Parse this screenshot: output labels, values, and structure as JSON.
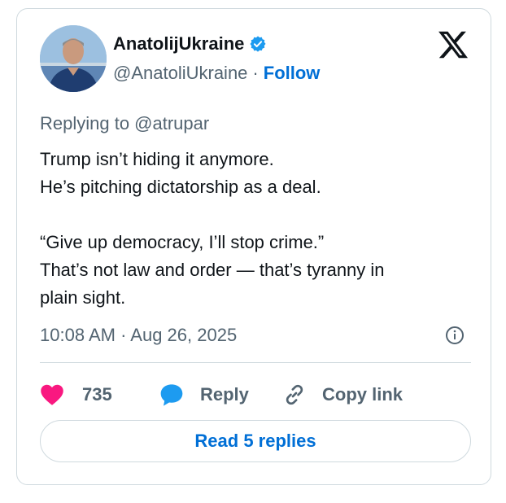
{
  "author": {
    "display_name": "AnatolijUkraine",
    "handle": "@AnatoliUkraine",
    "separator": "·",
    "follow_label": "Follow",
    "verified": true
  },
  "tweet": {
    "replying_to": "Replying to @atrupar",
    "lines": [
      "Trump isn’t hiding it anymore.",
      "He’s pitching dictatorship as a deal.",
      "",
      "“Give up democracy, I’ll stop crime.”",
      "That’s not law and order — that’s tyranny in",
      "plain sight."
    ],
    "timestamp": "10:08 AM · Aug 26, 2025"
  },
  "actions": {
    "like_count": "735",
    "reply_label": "Reply",
    "copy_link_label": "Copy link"
  },
  "read_replies_label": "Read 5 replies",
  "colors": {
    "accent": "#006fd6",
    "heart": "#f91880",
    "verified": "#1d9bf0",
    "reply_icon": "#1d9bf0",
    "muted_text": "#536471",
    "border": "#cfd9de"
  },
  "icons": [
    "verified-badge-icon",
    "x-logo-icon",
    "info-icon",
    "heart-icon",
    "reply-bubble-icon",
    "link-icon"
  ]
}
